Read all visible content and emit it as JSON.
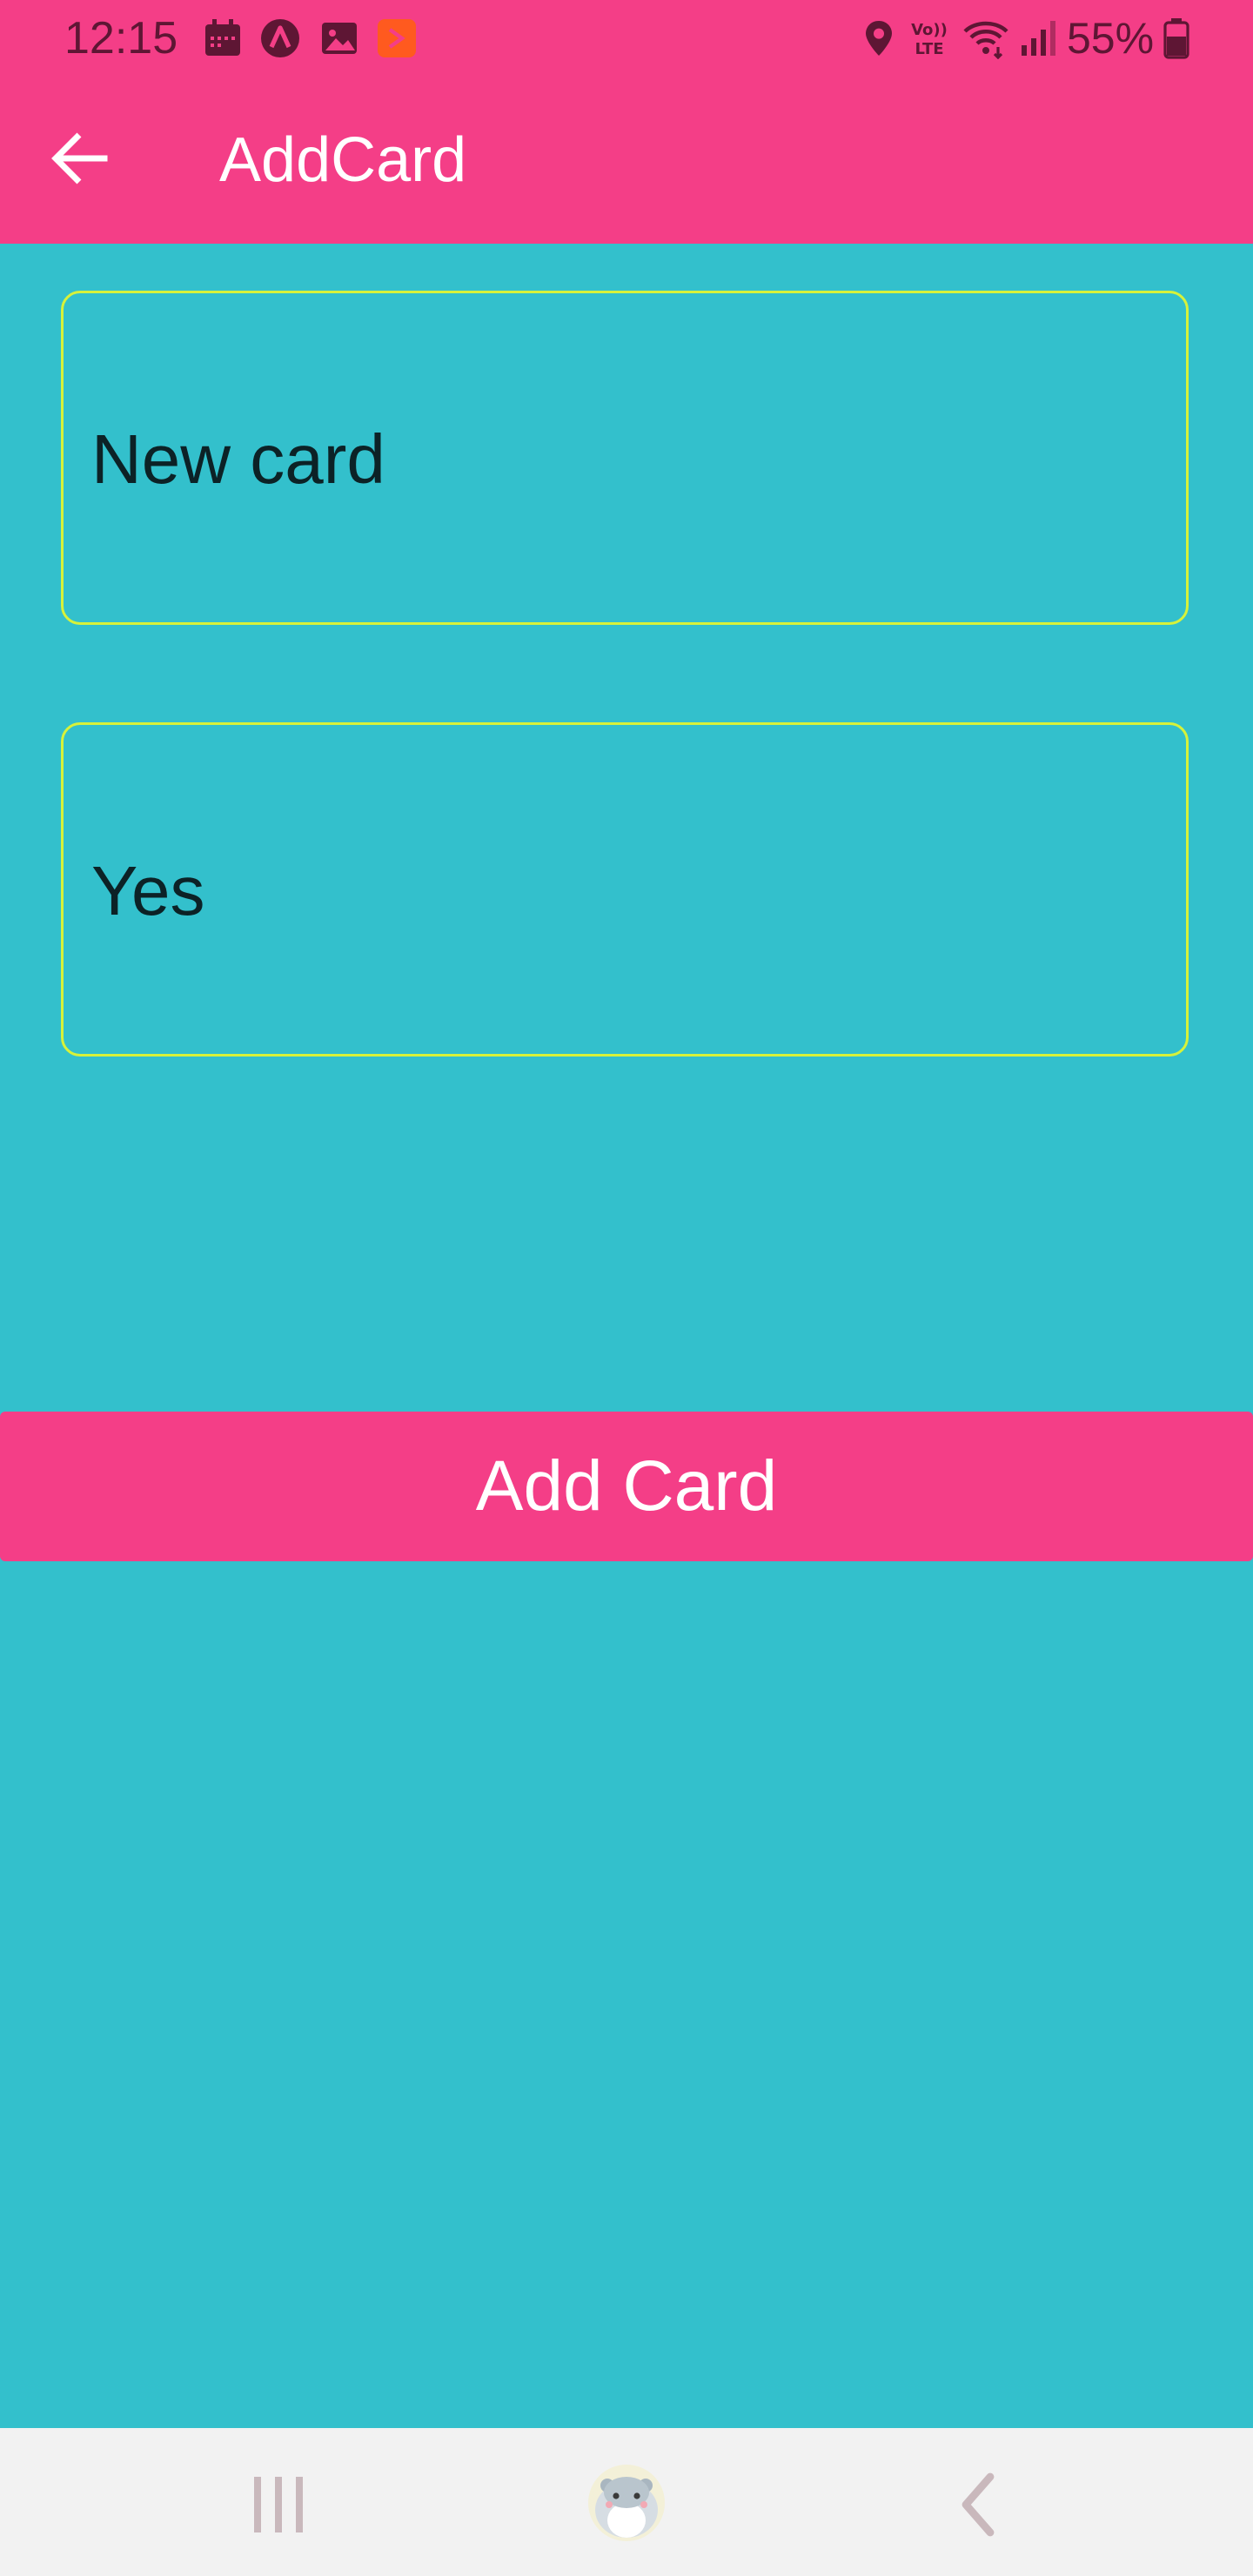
{
  "status_bar": {
    "time": "12:15",
    "battery": "55%",
    "notification_icons": [
      "calendar-icon",
      "app-a-icon",
      "gallery-icon",
      "app-orange-icon"
    ],
    "system_icons": [
      "location-icon",
      "volte-icon",
      "wifi-icon",
      "signal-icon",
      "battery-icon"
    ]
  },
  "app_bar": {
    "title": "AddCard",
    "back_icon": "arrow-left-icon"
  },
  "form": {
    "front_value": "New card",
    "back_value": "Yes"
  },
  "actions": {
    "add_card_label": "Add Card"
  },
  "nav_bar": {
    "items": [
      "recent-apps-icon",
      "home-icon",
      "back-icon"
    ]
  },
  "colors": {
    "primary": "#f43e87",
    "background": "#33c0cc",
    "field_border": "#d7f23a",
    "status_icon": "#5e1634"
  }
}
